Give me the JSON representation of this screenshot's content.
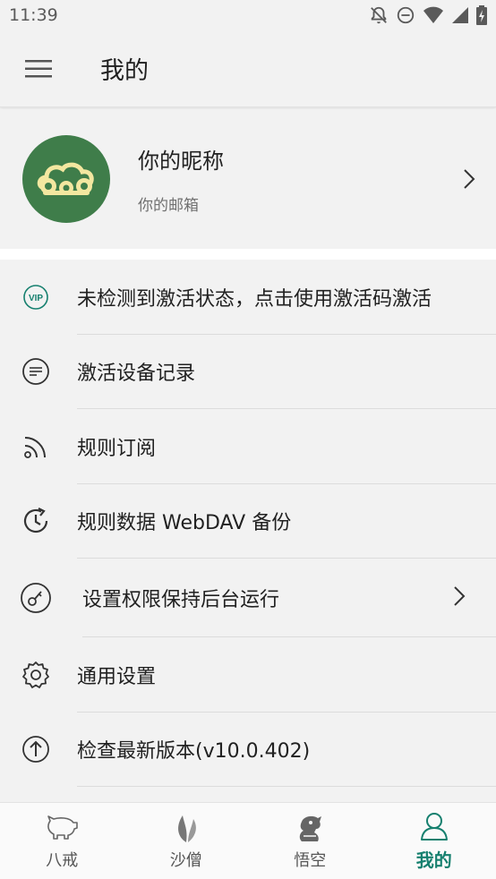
{
  "status_bar": {
    "time": "11:39"
  },
  "app_bar": {
    "title": "我的"
  },
  "profile": {
    "nickname": "你的昵称",
    "email": "你的邮箱"
  },
  "menu": [
    {
      "label": "未检测到激活状态，点击使用激活码激活",
      "icon": "vip-icon"
    },
    {
      "label": "激活设备记录",
      "icon": "device-list-icon"
    },
    {
      "label": "规则订阅",
      "icon": "rss-icon"
    },
    {
      "label": "规则数据 WebDAV 备份",
      "icon": "backup-clock-icon"
    },
    {
      "label": "设置权限保持后台运行",
      "icon": "background-run-icon"
    },
    {
      "label": "通用设置",
      "icon": "gear-icon"
    },
    {
      "label": "检查最新版本(v10.0.402)",
      "icon": "upload-arrow-icon"
    }
  ],
  "bottom_nav": [
    {
      "label": "八戒",
      "icon": "pig-icon",
      "active": false
    },
    {
      "label": "沙僧",
      "icon": "leaf-icon",
      "active": false
    },
    {
      "label": "悟空",
      "icon": "monkey-icon",
      "active": false
    },
    {
      "label": "我的",
      "icon": "person-icon",
      "active": true
    }
  ],
  "colors": {
    "accent": "#16806f",
    "avatar_bg": "#3f7d4a",
    "background": "#f2f2f2"
  }
}
